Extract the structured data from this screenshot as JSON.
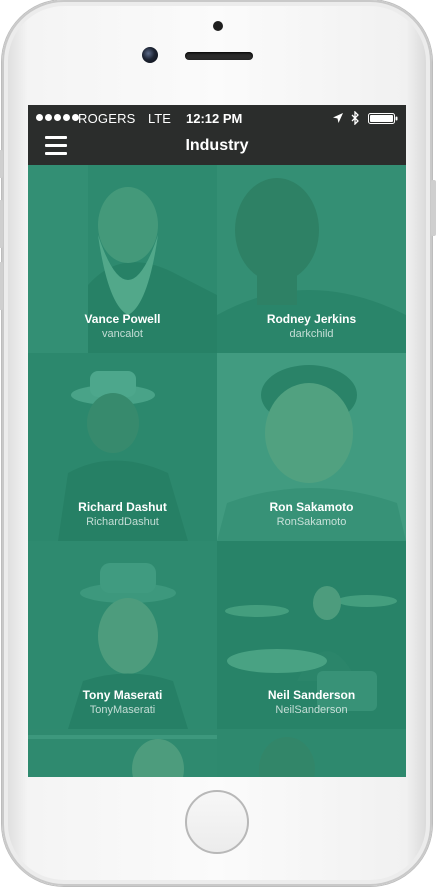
{
  "status_bar": {
    "carrier": "ROGERS",
    "network": "LTE",
    "time": "12:12 PM"
  },
  "navbar": {
    "title": "Industry"
  },
  "people": [
    {
      "name": "Vance Powell",
      "handle": "vancalot"
    },
    {
      "name": "Rodney Jerkins",
      "handle": "darkchild"
    },
    {
      "name": "Richard Dashut",
      "handle": "RichardDashut"
    },
    {
      "name": "Ron Sakamoto",
      "handle": "RonSakamoto"
    },
    {
      "name": "Tony Maserati",
      "handle": "TonyMaserati"
    },
    {
      "name": "Neil Sanderson",
      "handle": "NeilSanderson"
    }
  ],
  "colors": {
    "accent": "#2a9d7b",
    "navbar": "#2b2d2c"
  },
  "icons": [
    "menu-icon",
    "location-arrow-icon",
    "bluetooth-icon",
    "battery-icon"
  ]
}
